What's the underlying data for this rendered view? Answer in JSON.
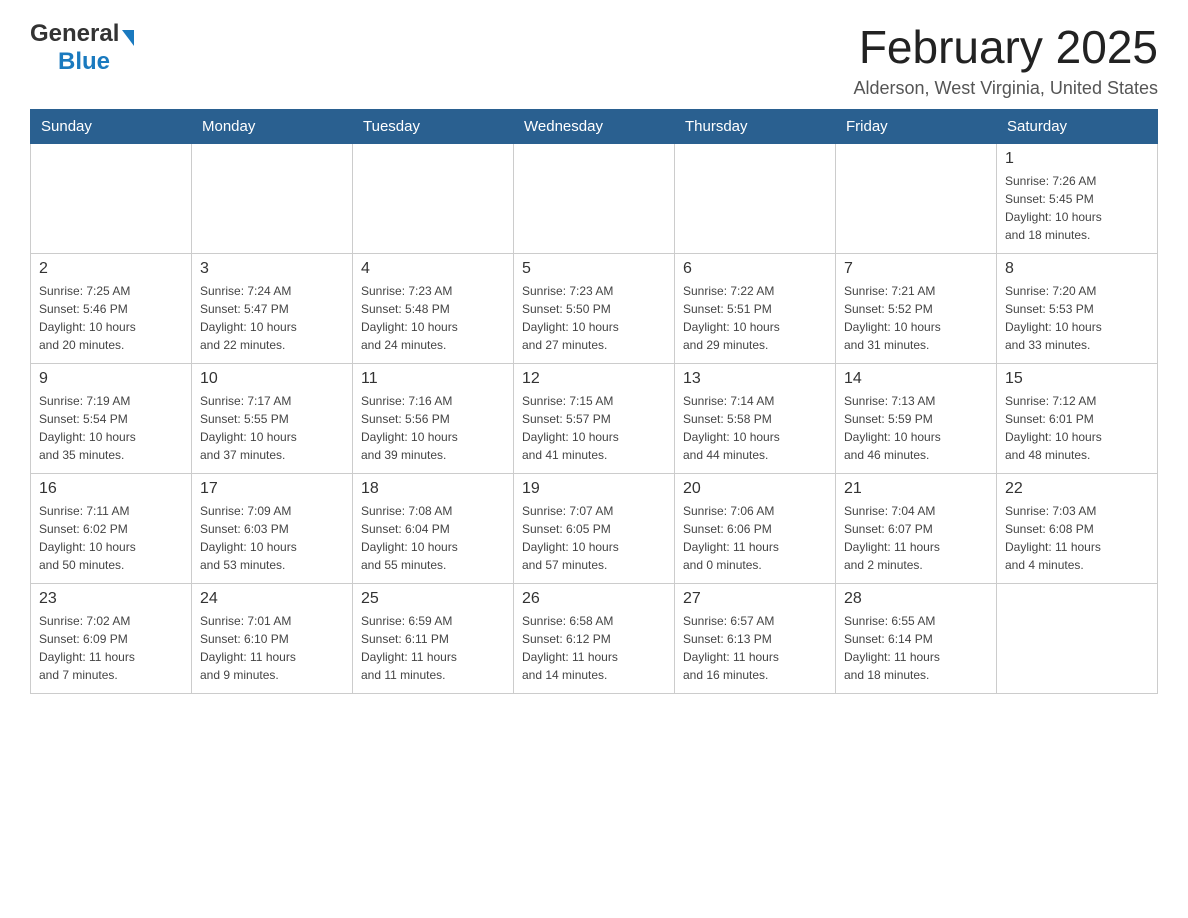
{
  "header": {
    "logo_general": "General",
    "logo_blue": "Blue",
    "month_title": "February 2025",
    "location": "Alderson, West Virginia, United States"
  },
  "weekdays": [
    "Sunday",
    "Monday",
    "Tuesday",
    "Wednesday",
    "Thursday",
    "Friday",
    "Saturday"
  ],
  "weeks": [
    [
      {
        "day": "",
        "info": ""
      },
      {
        "day": "",
        "info": ""
      },
      {
        "day": "",
        "info": ""
      },
      {
        "day": "",
        "info": ""
      },
      {
        "day": "",
        "info": ""
      },
      {
        "day": "",
        "info": ""
      },
      {
        "day": "1",
        "info": "Sunrise: 7:26 AM\nSunset: 5:45 PM\nDaylight: 10 hours\nand 18 minutes."
      }
    ],
    [
      {
        "day": "2",
        "info": "Sunrise: 7:25 AM\nSunset: 5:46 PM\nDaylight: 10 hours\nand 20 minutes."
      },
      {
        "day": "3",
        "info": "Sunrise: 7:24 AM\nSunset: 5:47 PM\nDaylight: 10 hours\nand 22 minutes."
      },
      {
        "day": "4",
        "info": "Sunrise: 7:23 AM\nSunset: 5:48 PM\nDaylight: 10 hours\nand 24 minutes."
      },
      {
        "day": "5",
        "info": "Sunrise: 7:23 AM\nSunset: 5:50 PM\nDaylight: 10 hours\nand 27 minutes."
      },
      {
        "day": "6",
        "info": "Sunrise: 7:22 AM\nSunset: 5:51 PM\nDaylight: 10 hours\nand 29 minutes."
      },
      {
        "day": "7",
        "info": "Sunrise: 7:21 AM\nSunset: 5:52 PM\nDaylight: 10 hours\nand 31 minutes."
      },
      {
        "day": "8",
        "info": "Sunrise: 7:20 AM\nSunset: 5:53 PM\nDaylight: 10 hours\nand 33 minutes."
      }
    ],
    [
      {
        "day": "9",
        "info": "Sunrise: 7:19 AM\nSunset: 5:54 PM\nDaylight: 10 hours\nand 35 minutes."
      },
      {
        "day": "10",
        "info": "Sunrise: 7:17 AM\nSunset: 5:55 PM\nDaylight: 10 hours\nand 37 minutes."
      },
      {
        "day": "11",
        "info": "Sunrise: 7:16 AM\nSunset: 5:56 PM\nDaylight: 10 hours\nand 39 minutes."
      },
      {
        "day": "12",
        "info": "Sunrise: 7:15 AM\nSunset: 5:57 PM\nDaylight: 10 hours\nand 41 minutes."
      },
      {
        "day": "13",
        "info": "Sunrise: 7:14 AM\nSunset: 5:58 PM\nDaylight: 10 hours\nand 44 minutes."
      },
      {
        "day": "14",
        "info": "Sunrise: 7:13 AM\nSunset: 5:59 PM\nDaylight: 10 hours\nand 46 minutes."
      },
      {
        "day": "15",
        "info": "Sunrise: 7:12 AM\nSunset: 6:01 PM\nDaylight: 10 hours\nand 48 minutes."
      }
    ],
    [
      {
        "day": "16",
        "info": "Sunrise: 7:11 AM\nSunset: 6:02 PM\nDaylight: 10 hours\nand 50 minutes."
      },
      {
        "day": "17",
        "info": "Sunrise: 7:09 AM\nSunset: 6:03 PM\nDaylight: 10 hours\nand 53 minutes."
      },
      {
        "day": "18",
        "info": "Sunrise: 7:08 AM\nSunset: 6:04 PM\nDaylight: 10 hours\nand 55 minutes."
      },
      {
        "day": "19",
        "info": "Sunrise: 7:07 AM\nSunset: 6:05 PM\nDaylight: 10 hours\nand 57 minutes."
      },
      {
        "day": "20",
        "info": "Sunrise: 7:06 AM\nSunset: 6:06 PM\nDaylight: 11 hours\nand 0 minutes."
      },
      {
        "day": "21",
        "info": "Sunrise: 7:04 AM\nSunset: 6:07 PM\nDaylight: 11 hours\nand 2 minutes."
      },
      {
        "day": "22",
        "info": "Sunrise: 7:03 AM\nSunset: 6:08 PM\nDaylight: 11 hours\nand 4 minutes."
      }
    ],
    [
      {
        "day": "23",
        "info": "Sunrise: 7:02 AM\nSunset: 6:09 PM\nDaylight: 11 hours\nand 7 minutes."
      },
      {
        "day": "24",
        "info": "Sunrise: 7:01 AM\nSunset: 6:10 PM\nDaylight: 11 hours\nand 9 minutes."
      },
      {
        "day": "25",
        "info": "Sunrise: 6:59 AM\nSunset: 6:11 PM\nDaylight: 11 hours\nand 11 minutes."
      },
      {
        "day": "26",
        "info": "Sunrise: 6:58 AM\nSunset: 6:12 PM\nDaylight: 11 hours\nand 14 minutes."
      },
      {
        "day": "27",
        "info": "Sunrise: 6:57 AM\nSunset: 6:13 PM\nDaylight: 11 hours\nand 16 minutes."
      },
      {
        "day": "28",
        "info": "Sunrise: 6:55 AM\nSunset: 6:14 PM\nDaylight: 11 hours\nand 18 minutes."
      },
      {
        "day": "",
        "info": ""
      }
    ]
  ]
}
